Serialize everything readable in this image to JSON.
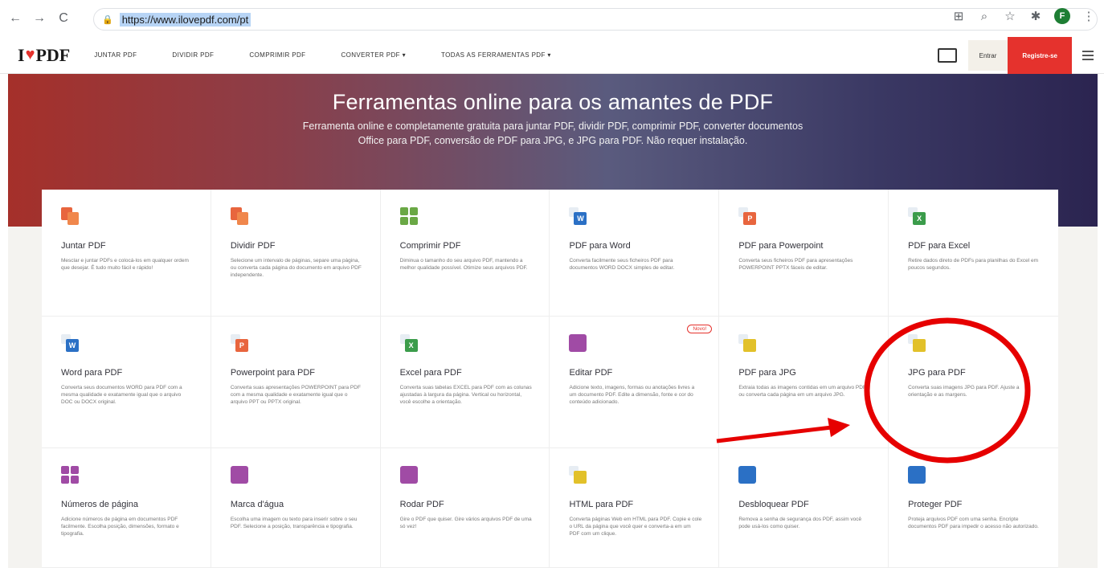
{
  "browser": {
    "url": "https://www.ilovepdf.com/pt",
    "profile_initial": "F",
    "nav_back": "←",
    "nav_forward": "→",
    "nav_reload": "C",
    "icons": [
      "qr-icon",
      "zoom-icon",
      "star-icon",
      "extensions-icon"
    ]
  },
  "site": {
    "logo_left": "I",
    "logo_right": "PDF",
    "nav": [
      "JUNTAR PDF",
      "DIVIDIR PDF",
      "COMPRIMIR PDF",
      "CONVERTER PDF ▾",
      "TODAS AS FERRAMENTAS PDF ▾"
    ],
    "login": "Entrar",
    "register": "Registre-se"
  },
  "hero": {
    "title": "Ferramentas online para os amantes de PDF",
    "subtitle": "Ferramenta online e completamente gratuita para juntar PDF, dividir PDF, comprimir PDF, converter documentos Office para PDF, conversão de PDF para JPG, e JPG para PDF. Não requer instalação."
  },
  "tools": [
    {
      "name": "Juntar PDF",
      "desc": "Mesclar e juntar PDFs e colocá-los em qualquer ordem que desejar. É tudo muito fácil e rápido!",
      "icon": "merge-icon",
      "color": "#e8653e"
    },
    {
      "name": "Dividir PDF",
      "desc": "Selecione um intervalo de páginas, separe uma página, ou converta cada página do documento em arquivo PDF independente.",
      "icon": "split-icon",
      "color": "#e8653e"
    },
    {
      "name": "Comprimir PDF",
      "desc": "Diminua o tamanho do seu arquivo PDF, mantendo a melhor qualidade possível. Otimize seus arquivos PDF.",
      "icon": "compress-icon",
      "color": "#6aa845"
    },
    {
      "name": "PDF para Word",
      "desc": "Converta facilmente seus ficheiros PDF para documentos WORD DOCX simples de editar.",
      "icon": "word-icon",
      "color": "#2b70c5",
      "letter": "W"
    },
    {
      "name": "PDF para Powerpoint",
      "desc": "Converta seus ficheiros PDF para apresentações POWERPOINT PPTX fáceis de editar.",
      "icon": "powerpoint-icon",
      "color": "#e8653e",
      "letter": "P"
    },
    {
      "name": "PDF para Excel",
      "desc": "Retire dados direto de PDFs para planilhas do Excel em poucos segundos.",
      "icon": "excel-icon",
      "color": "#3b9c4b",
      "letter": "X"
    },
    {
      "name": "Word para PDF",
      "desc": "Converta seus documentos WORD para PDF com a mesma qualidade e exatamente igual que o arquivo DOC ou DOCX original.",
      "icon": "word-to-pdf-icon",
      "color": "#2b70c5",
      "letter": "W"
    },
    {
      "name": "Powerpoint para PDF",
      "desc": "Converta suas apresentações POWERPOINT para PDF com a mesma qualidade e exatamente igual que o arquivo PPT ou PPTX original.",
      "icon": "ppt-to-pdf-icon",
      "color": "#e8653e",
      "letter": "P"
    },
    {
      "name": "Excel para PDF",
      "desc": "Converta suas tabelas EXCEL para PDF com as colunas ajustadas à largura da página. Vertical ou horizontal, você escolhe a orientação.",
      "icon": "excel-to-pdf-icon",
      "color": "#3b9c4b",
      "letter": "X"
    },
    {
      "name": "Editar PDF",
      "desc": "Adicione texto, imagens, formas ou anotações livres a um documento PDF. Edite a dimensão, fonte e cor do conteúdo adicionado.",
      "icon": "edit-icon",
      "color": "#a04ba5",
      "badge": "Novo!"
    },
    {
      "name": "PDF para JPG",
      "desc": "Extraia todas as imagens contidas em um arquivo PDF ou converta cada página em um arquivo JPG.",
      "icon": "pdf-to-jpg-icon",
      "color": "#e2c12a"
    },
    {
      "name": "JPG para PDF",
      "desc": "Converta suas imagens JPG para PDF. Ajuste a orientação e as margens.",
      "icon": "jpg-to-pdf-icon",
      "color": "#e2c12a"
    },
    {
      "name": "Números de página",
      "desc": "Adicione números de página em documentos PDF facilmente. Escolha posição, dimensões, formato e tipografia.",
      "icon": "page-numbers-icon",
      "color": "#a04ba5"
    },
    {
      "name": "Marca d'água",
      "desc": "Escolha uma imagem ou texto para inserir sobre o seu PDF. Selecione a posição, transparência e tipografia.",
      "icon": "watermark-icon",
      "color": "#a04ba5"
    },
    {
      "name": "Rodar PDF",
      "desc": "Gire o PDF que quiser. Gire vários arquivos PDF de uma só vez!",
      "icon": "rotate-icon",
      "color": "#a04ba5"
    },
    {
      "name": "HTML para PDF",
      "desc": "Converta páginas Web em HTML para PDF. Copie e cole o URL da página que você quer e converta-a em um PDF com um clique.",
      "icon": "html-icon",
      "color": "#e2c12a"
    },
    {
      "name": "Desbloquear PDF",
      "desc": "Remova a senha de segurança dos PDF, assim você pode usá-los como quiser.",
      "icon": "unlock-icon",
      "color": "#2b70c5"
    },
    {
      "name": "Proteger PDF",
      "desc": "Proteja arquivos PDF com uma senha. Encripte documentos PDF para impedir o acesso não autorizado.",
      "icon": "protect-icon",
      "color": "#2b70c5"
    }
  ],
  "annotation": {
    "stroke_color": "#e60000"
  }
}
